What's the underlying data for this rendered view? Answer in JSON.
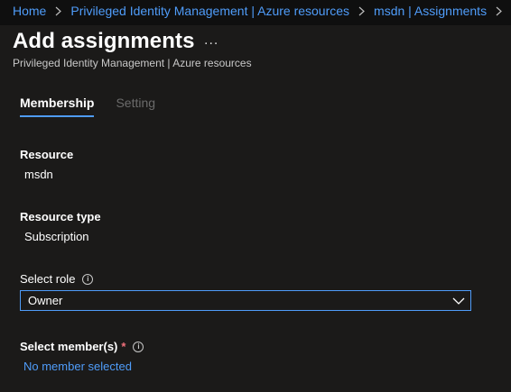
{
  "breadcrumb": {
    "items": [
      "Home",
      "Privileged Identity Management | Azure resources",
      "msdn | Assignments"
    ]
  },
  "header": {
    "title": "Add assignments",
    "more": "...",
    "subtitle": "Privileged Identity Management | Azure resources"
  },
  "tabs": [
    {
      "label": "Membership",
      "active": true
    },
    {
      "label": "Setting",
      "active": false
    }
  ],
  "resource": {
    "label": "Resource",
    "value": "msdn"
  },
  "resource_type": {
    "label": "Resource type",
    "value": "Subscription"
  },
  "select_role": {
    "label": "Select role",
    "value": "Owner"
  },
  "select_members": {
    "label": "Select member(s)",
    "required_mark": "*",
    "link": "No member selected"
  },
  "colors": {
    "accent": "#4f9cf9",
    "required": "#f1707b",
    "background": "#1b1a19"
  }
}
